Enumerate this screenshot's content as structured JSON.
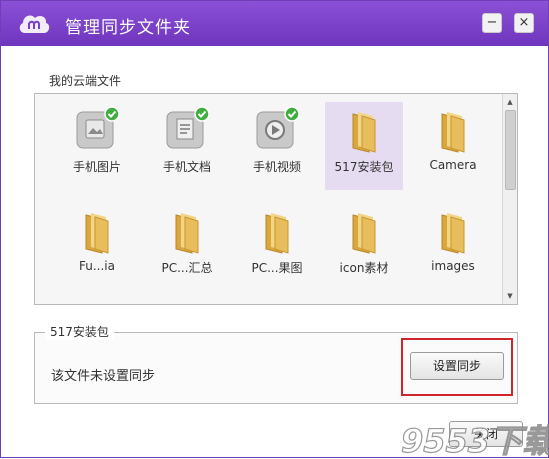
{
  "window": {
    "title": "管理同步文件夹"
  },
  "controls": {
    "minimize": "−",
    "close": "×"
  },
  "cloud_files": {
    "section_label": "我的云端文件",
    "items": [
      {
        "label": "手机图片",
        "icon": "photo-icon",
        "synced": true
      },
      {
        "label": "手机文档",
        "icon": "document-icon",
        "synced": true
      },
      {
        "label": "手机视频",
        "icon": "video-icon",
        "synced": true
      },
      {
        "label": "517安装包",
        "icon": "folder-icon",
        "selected": true
      },
      {
        "label": "Camera",
        "icon": "folder-icon"
      },
      {
        "label": "Fu...ia",
        "icon": "folder-icon"
      },
      {
        "label": "PC...汇总",
        "icon": "folder-icon"
      },
      {
        "label": "PC...果图",
        "icon": "folder-icon"
      },
      {
        "label": "icon素材",
        "icon": "folder-icon"
      },
      {
        "label": "images",
        "icon": "folder-icon"
      }
    ]
  },
  "sync_settings": {
    "folder_name": "517安装包",
    "status_text": "该文件未设置同步",
    "setup_button": "设置同步"
  },
  "footer": {
    "close_button": "关闭"
  },
  "watermark": "9553下载",
  "colors": {
    "titlebar": "#7b41c8",
    "selection": "#e6dcf2",
    "highlight": "#d0262b"
  }
}
